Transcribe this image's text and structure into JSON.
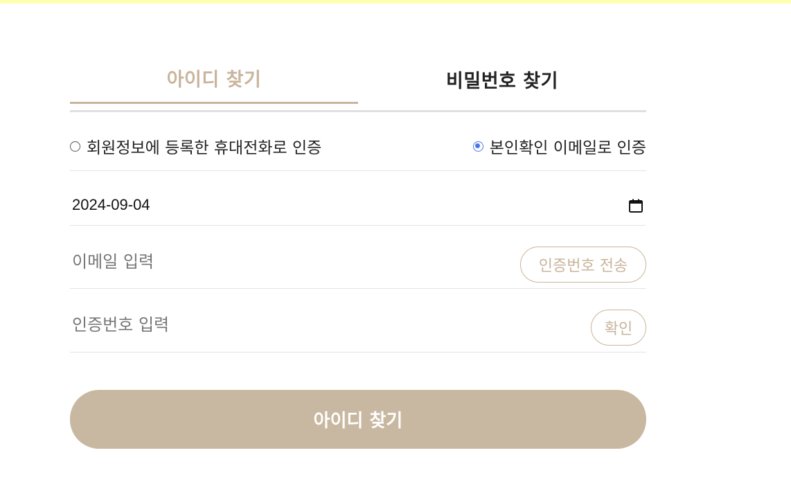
{
  "tabs": {
    "find_id": "아이디 찾기",
    "find_password": "비밀번호 찾기"
  },
  "auth_options": {
    "phone_label": "회원정보에 등록한 휴대전화로 인증",
    "email_label": "본인확인 이메일로 인증",
    "selected": "email"
  },
  "birth_date": {
    "value": "2024-09-04"
  },
  "email": {
    "placeholder": "이메일 입력",
    "send_button": "인증번호 전송"
  },
  "code": {
    "placeholder": "인증번호 입력",
    "confirm_button": "확인"
  },
  "submit": {
    "label": "아이디 찾기"
  },
  "colors": {
    "accent": "#c9b49c",
    "submit_bg": "#c9b8a1",
    "radio_checked": "#4a76e8",
    "top_bar": "#ffffb0"
  }
}
